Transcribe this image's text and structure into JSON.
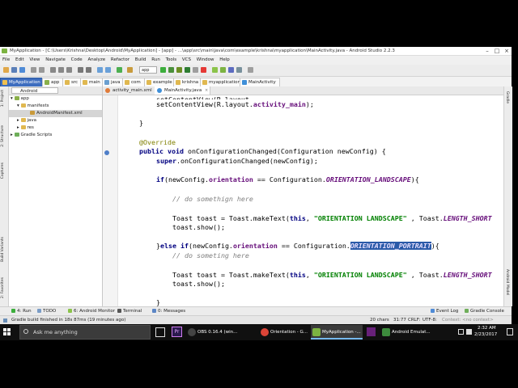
{
  "window": {
    "title": "MyApplication - [C:\\Users\\Krishna\\Desktop\\Android\\MyApplication] - [app] - ...\\app\\src\\main\\java\\com\\example\\krishna\\myapplication\\MainActivity.java - Android Studio 2.2.3",
    "minimize": "–",
    "maximize": "□",
    "close": "×"
  },
  "menu": [
    "File",
    "Edit",
    "View",
    "Navigate",
    "Code",
    "Analyze",
    "Refactor",
    "Build",
    "Run",
    "Tools",
    "VCS",
    "Window",
    "Help"
  ],
  "toolbar": {
    "run_config": "app"
  },
  "breadcrumbs": [
    "MyApplication",
    "app",
    "src",
    "main",
    "java",
    "com",
    "example",
    "krishna",
    "myapplication",
    "MainActivity"
  ],
  "left_tools": [
    "1: Project",
    "2: Structure",
    "Captures",
    "Build Variants",
    "2: Favorites"
  ],
  "right_tools": [
    "Gradle",
    "Android Model"
  ],
  "project": {
    "view_mode": "Android",
    "tree": [
      {
        "label": "app",
        "level": 0
      },
      {
        "label": "manifests",
        "level": 1
      },
      {
        "label": "AndroidManifest.xml",
        "level": 2,
        "selected": true
      },
      {
        "label": "java",
        "level": 1
      },
      {
        "label": "res",
        "level": 1
      },
      {
        "label": "Gradle Scripts",
        "level": 0
      }
    ]
  },
  "editor": {
    "tabs": [
      {
        "label": "activity_main.xml",
        "active": false
      },
      {
        "label": "MainActivity.java",
        "active": true
      }
    ]
  },
  "code": {
    "l_setcontent": "setContentView(R.layout.",
    "l_setcontent_field": "activity_main",
    "l_setcontent_end": ");",
    "brace_close": "}",
    "annotation": "@Override",
    "l_method_kw": "public void",
    "l_method_rest": " onConfigurationChanged(Configuration newConfig) {",
    "l_super_kw": "super",
    "l_super_rest": ".onConfigurationChanged(newConfig);",
    "l_if_kw": "if",
    "l_if_mid": "(newConfig.",
    "l_if_field": "orientation",
    "l_if_eq": " == Configuration.",
    "const_landscape": "ORIENTATION_LANDSCAPE",
    "l_if_end": "){",
    "cmt1": "// do somethign here",
    "toast_start": "Toast toast = Toast.makeText(",
    "kw_this": "this",
    "str_landscape": "\"ORIENTATION LANDSCAPE\"",
    "toast_mid": " , Toast.",
    "const_length": "LENGTH_SHORT",
    "toast_show": "toast.show();",
    "l_else_open": "}",
    "kw_else": "else",
    "kw_if": "if",
    "const_portrait": "ORIENTATION_PORTRAIT",
    "cmt2": "// do someting here"
  },
  "bottom_tabs": [
    "4: Run",
    "TODO",
    "6: Android Monitor",
    "Terminal",
    "0: Messages",
    "Event Log",
    "Gradle Console"
  ],
  "status": {
    "message": "Gradle build finished in 18s 87ms (19 minutes ago)",
    "chars": "20 chars",
    "position": "31:77",
    "line_sep": "CRLF:",
    "encoding": "UTF-8:",
    "context": "Context: <no context>"
  },
  "taskbar": {
    "search_placeholder": "Ask me anything",
    "apps": [
      {
        "label": "OBS 0.16.4 (win...",
        "active": false
      },
      {
        "label": "Orientation - G...",
        "active": false
      },
      {
        "label": "MyApplication -...",
        "active": true
      },
      {
        "label": "Android Emulat...",
        "active": false
      }
    ],
    "time": "2:32 AM",
    "date": "2/23/2017"
  }
}
